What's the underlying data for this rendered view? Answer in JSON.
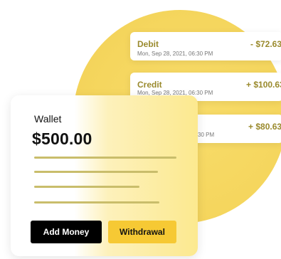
{
  "transactions": [
    {
      "type": "Debit",
      "date": "Mon, Sep 28, 2021, 06:30 PM",
      "amount": "- $72.63"
    },
    {
      "type": "Credit",
      "date": "Mon, Sep 28, 2021, 06:30 PM",
      "amount": "+ $100.63"
    },
    {
      "type": "",
      "date": "30 PM",
      "amount": "+ $80.63"
    }
  ],
  "wallet": {
    "title": "Wallet",
    "balance": "$500.00",
    "add_label": "Add Money",
    "withdraw_label": "Withdrawal"
  },
  "colors": {
    "accent": "#f6c934",
    "circle": "#f5d65e",
    "amount_text": "#9a8a2d"
  }
}
